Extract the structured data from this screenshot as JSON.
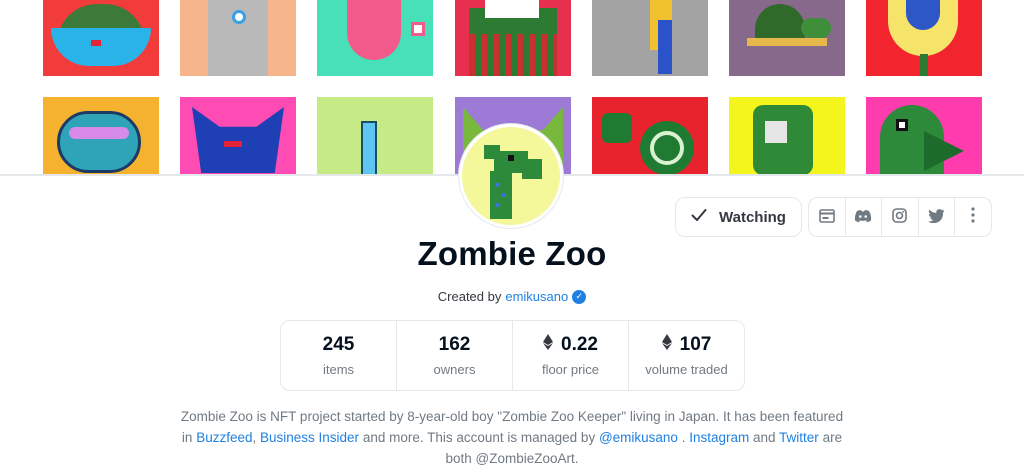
{
  "collection": {
    "title": "Zombie Zoo",
    "created_by_label": "Created by",
    "creator": "emikusano"
  },
  "actions": {
    "watch_label": "Watching",
    "social_icons": [
      "website-icon",
      "discord-icon",
      "instagram-icon",
      "twitter-icon",
      "more-icon"
    ]
  },
  "stats": [
    {
      "value": "245",
      "label": "items",
      "eth": false
    },
    {
      "value": "162",
      "label": "owners",
      "eth": false
    },
    {
      "value": "0.22",
      "label": "floor price",
      "eth": true
    },
    {
      "value": "107",
      "label": "volume traded",
      "eth": true
    }
  ],
  "description": {
    "p1": "Zombie Zoo is NFT project started by 8-year-old boy \"Zombie Zoo Keeper\" living in Japan. It has been featured in ",
    "link1": "Buzzfeed",
    "sep1": ", ",
    "link2": "Business Insider",
    "p2": " and more. This account is managed by ",
    "link3": "@emikusano",
    "p3": " . ",
    "link4": "Instagram",
    "p4": " and ",
    "link5": "Twitter",
    "p5": " are both @ZombieZooArt."
  },
  "colors": {
    "accent": "#2081e2",
    "text_primary": "#04111d",
    "text_secondary": "#707a83",
    "border": "#e5e8eb"
  }
}
